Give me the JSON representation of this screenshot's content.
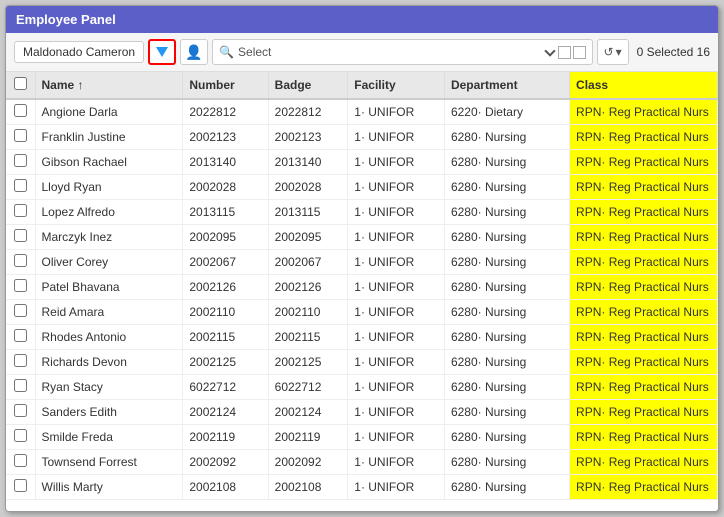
{
  "panel": {
    "title": "Employee Panel"
  },
  "toolbar": {
    "employee_tag": "Maldonado Cameron",
    "search_placeholder": "Select",
    "selected_count": "0 Selected 16",
    "reset_label": "↺"
  },
  "table": {
    "columns": [
      {
        "id": "check",
        "label": ""
      },
      {
        "id": "name",
        "label": "Name ↑"
      },
      {
        "id": "number",
        "label": "Number"
      },
      {
        "id": "badge",
        "label": "Badge"
      },
      {
        "id": "facility",
        "label": "Facility"
      },
      {
        "id": "department",
        "label": "Department"
      },
      {
        "id": "class",
        "label": "Class"
      }
    ],
    "rows": [
      {
        "name": "Angione Darla",
        "number": "2022812",
        "badge": "2022812",
        "facility": "1· UNIFOR",
        "department": "6220· Dietary",
        "class": "RPN· Reg Practical Nurs"
      },
      {
        "name": "Franklin Justine",
        "number": "2002123",
        "badge": "2002123",
        "facility": "1· UNIFOR",
        "department": "6280· Nursing",
        "class": "RPN· Reg Practical Nurs"
      },
      {
        "name": "Gibson Rachael",
        "number": "2013140",
        "badge": "2013140",
        "facility": "1· UNIFOR",
        "department": "6280· Nursing",
        "class": "RPN· Reg Practical Nurs"
      },
      {
        "name": "Lloyd Ryan",
        "number": "2002028",
        "badge": "2002028",
        "facility": "1· UNIFOR",
        "department": "6280· Nursing",
        "class": "RPN· Reg Practical Nurs"
      },
      {
        "name": "Lopez Alfredo",
        "number": "2013115",
        "badge": "2013115",
        "facility": "1· UNIFOR",
        "department": "6280· Nursing",
        "class": "RPN· Reg Practical Nurs"
      },
      {
        "name": "Marczyk Inez",
        "number": "2002095",
        "badge": "2002095",
        "facility": "1· UNIFOR",
        "department": "6280· Nursing",
        "class": "RPN· Reg Practical Nurs"
      },
      {
        "name": "Oliver Corey",
        "number": "2002067",
        "badge": "2002067",
        "facility": "1· UNIFOR",
        "department": "6280· Nursing",
        "class": "RPN· Reg Practical Nurs"
      },
      {
        "name": "Patel Bhavana",
        "number": "2002126",
        "badge": "2002126",
        "facility": "1· UNIFOR",
        "department": "6280· Nursing",
        "class": "RPN· Reg Practical Nurs"
      },
      {
        "name": "Reid Amara",
        "number": "2002110",
        "badge": "2002110",
        "facility": "1· UNIFOR",
        "department": "6280· Nursing",
        "class": "RPN· Reg Practical Nurs"
      },
      {
        "name": "Rhodes Antonio",
        "number": "2002115",
        "badge": "2002115",
        "facility": "1· UNIFOR",
        "department": "6280· Nursing",
        "class": "RPN· Reg Practical Nurs"
      },
      {
        "name": "Richards Devon",
        "number": "2002125",
        "badge": "2002125",
        "facility": "1· UNIFOR",
        "department": "6280· Nursing",
        "class": "RPN· Reg Practical Nurs"
      },
      {
        "name": "Ryan Stacy",
        "number": "6022712",
        "badge": "6022712",
        "facility": "1· UNIFOR",
        "department": "6280· Nursing",
        "class": "RPN· Reg Practical Nurs"
      },
      {
        "name": "Sanders Edith",
        "number": "2002124",
        "badge": "2002124",
        "facility": "1· UNIFOR",
        "department": "6280· Nursing",
        "class": "RPN· Reg Practical Nurs"
      },
      {
        "name": "Smilde Freda",
        "number": "2002119",
        "badge": "2002119",
        "facility": "1· UNIFOR",
        "department": "6280· Nursing",
        "class": "RPN· Reg Practical Nurs"
      },
      {
        "name": "Townsend Forrest",
        "number": "2002092",
        "badge": "2002092",
        "facility": "1· UNIFOR",
        "department": "6280· Nursing",
        "class": "RPN· Reg Practical Nurs"
      },
      {
        "name": "Willis Marty",
        "number": "2002108",
        "badge": "2002108",
        "facility": "1· UNIFOR",
        "department": "6280· Nursing",
        "class": "RPN· Reg Practical Nurs"
      }
    ]
  }
}
